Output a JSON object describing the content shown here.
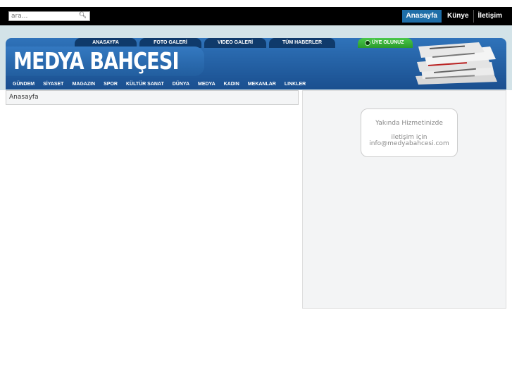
{
  "search": {
    "placeholder": "ara...",
    "icon": "search-icon"
  },
  "top_links": [
    {
      "label": "Anasayfa",
      "active": true
    },
    {
      "label": "Künye",
      "active": false
    },
    {
      "label": "İletişim",
      "active": false
    }
  ],
  "header": {
    "logo": "MEDYA BAHÇESI",
    "top_nav": [
      "ANASAYFA",
      "FOTO GALERİ",
      "VIDEO GALERİ",
      "TÜM HABERLER"
    ],
    "member_link": "ÜYE OLUNUZ",
    "categories": [
      "GÜNDEM",
      "SİYASET",
      "MAGAZIN",
      "SPOR",
      "KÜLTÜR SANAT",
      "DÜNYA",
      "MEDYA",
      "KADIN",
      "MEKANLAR",
      "LINKLER"
    ]
  },
  "breadcrumb": "Anasayfa",
  "sidebar_notice": {
    "line1": "Yakında Hizmetinizde",
    "line2": "iletişim için",
    "line3": "info@medyabahcesi.com"
  },
  "colors": {
    "active_link": "#1e6ea8",
    "banner": "#2f73ba",
    "member": "#3cb43d"
  }
}
